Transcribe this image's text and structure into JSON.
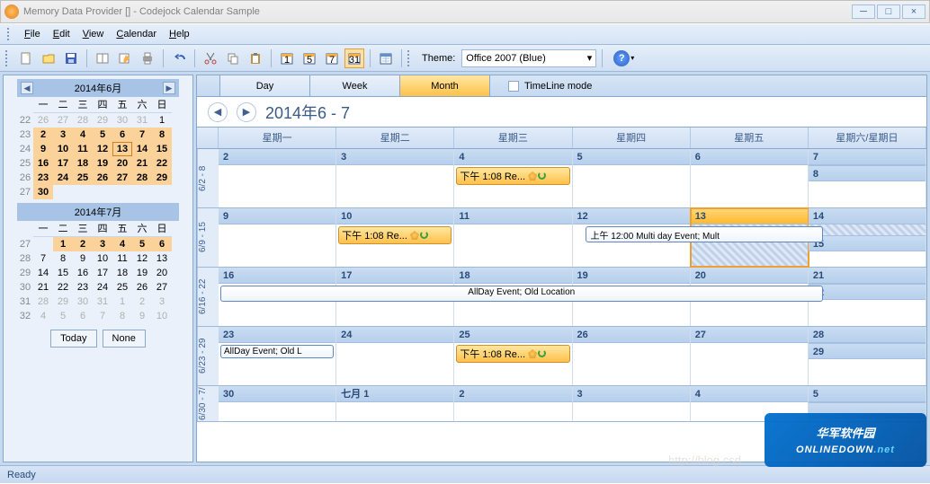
{
  "window": {
    "title": "Memory Data Provider [] -  Codejock Calendar Sample"
  },
  "menu": {
    "file": "File",
    "edit": "Edit",
    "view": "View",
    "calendar": "Calendar",
    "help": "Help"
  },
  "toolbar": {
    "theme_label": "Theme:",
    "theme_value": "Office 2007 (Blue)"
  },
  "view_tabs": {
    "day": "Day",
    "week": "Week",
    "month": "Month",
    "timeline": "TimeLine mode"
  },
  "range": {
    "title": "2014年6 - 7"
  },
  "day_headers": [
    "星期一",
    "星期二",
    "星期三",
    "星期四",
    "星期五",
    "星期六/星期日"
  ],
  "minical1": {
    "title": "2014年6月",
    "dow": [
      "一",
      "二",
      "三",
      "四",
      "五",
      "六",
      "日"
    ],
    "wknums": [
      "22",
      "23",
      "24",
      "25",
      "26",
      "27"
    ],
    "cells": [
      [
        "26",
        "27",
        "28",
        "29",
        "30",
        "31",
        "1"
      ],
      [
        "2",
        "3",
        "4",
        "5",
        "6",
        "7",
        "8"
      ],
      [
        "9",
        "10",
        "11",
        "12",
        "13",
        "14",
        "15"
      ],
      [
        "16",
        "17",
        "18",
        "19",
        "20",
        "21",
        "22"
      ],
      [
        "23",
        "24",
        "25",
        "26",
        "27",
        "28",
        "29"
      ],
      [
        "30",
        "",
        "",
        "",
        "",
        "",
        ""
      ]
    ]
  },
  "minical2": {
    "title": "2014年7月",
    "dow": [
      "一",
      "二",
      "三",
      "四",
      "五",
      "六",
      "日"
    ],
    "wknums": [
      "27",
      "28",
      "29",
      "30",
      "31",
      "32"
    ],
    "cells": [
      [
        "",
        "1",
        "2",
        "3",
        "4",
        "5",
        "6"
      ],
      [
        "7",
        "8",
        "9",
        "10",
        "11",
        "12",
        "13"
      ],
      [
        "14",
        "15",
        "16",
        "17",
        "18",
        "19",
        "20"
      ],
      [
        "21",
        "22",
        "23",
        "24",
        "25",
        "26",
        "27"
      ],
      [
        "28",
        "29",
        "30",
        "31",
        "1",
        "2",
        "3"
      ],
      [
        "4",
        "5",
        "6",
        "7",
        "8",
        "9",
        "10"
      ]
    ]
  },
  "sidebar_btns": {
    "today": "Today",
    "none": "None"
  },
  "weeks": [
    {
      "label": "6/2 - 8",
      "dates": [
        "2",
        "3",
        "4",
        "5",
        "6",
        "7",
        "8"
      ]
    },
    {
      "label": "6/9 - 15",
      "dates": [
        "9",
        "10",
        "11",
        "12",
        "13",
        "14",
        "15"
      ]
    },
    {
      "label": "6/16 - 22",
      "dates": [
        "16",
        "17",
        "18",
        "19",
        "20",
        "21",
        "22"
      ]
    },
    {
      "label": "6/23 - 29",
      "dates": [
        "23",
        "24",
        "25",
        "26",
        "27",
        "28",
        "29"
      ]
    },
    {
      "label": "6/30 - 7/",
      "dates": [
        "30",
        "七月 1",
        "2",
        "3",
        "4",
        "5",
        ""
      ]
    }
  ],
  "events": {
    "recur": "下午 1:08  Re...",
    "multi": "上午 12:00  Multi day Event; Mult",
    "allday_span": "AllDay Event; Old Location",
    "allday_short": "AllDay Event; Old L"
  },
  "status": "Ready",
  "watermark": {
    "cn": "华军软件园",
    "en": "ONLINEDOWN",
    "url_hint": "http://blog.csd"
  }
}
